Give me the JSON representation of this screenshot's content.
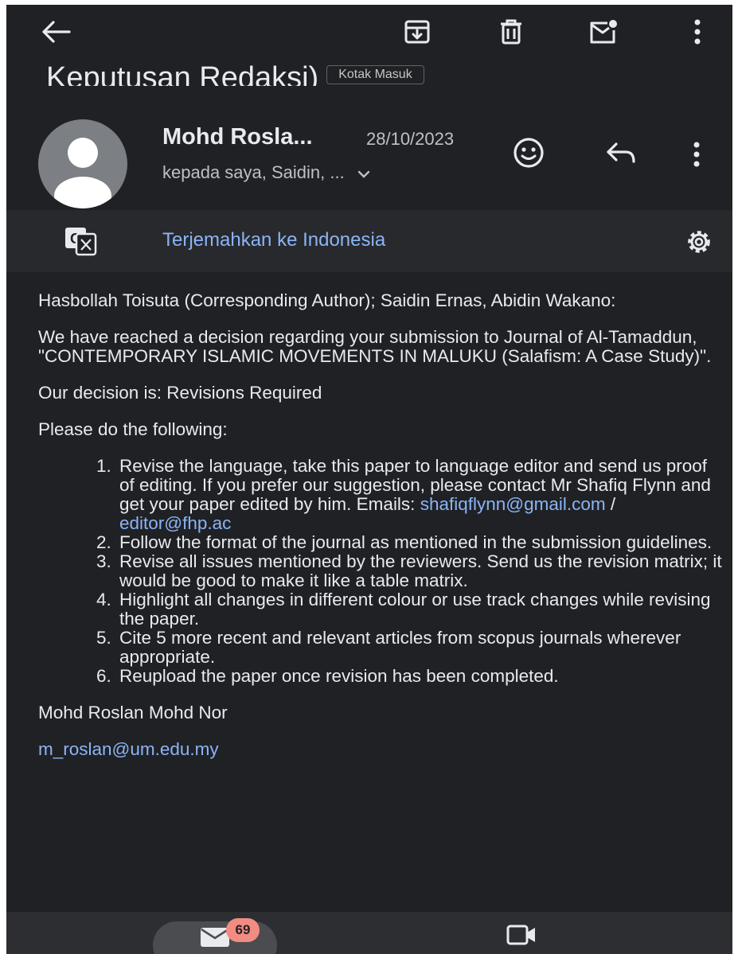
{
  "email": {
    "subject_tail": "Keputusan Redaksi)",
    "label": "Kotak Masuk",
    "sender": "Mohd Rosla...",
    "date": "28/10/2023",
    "recipients": "kepada saya, Saidin, ..."
  },
  "translate": {
    "label": "Terjemahkan ke Indonesia"
  },
  "body": {
    "salutation": "Hasbollah Toisuta (Corresponding Author); Saidin Ernas, Abidin Wakano:",
    "intro": "We have reached a decision regarding your submission to Journal of Al-Tamaddun, \"CONTEMPORARY ISLAMIC MOVEMENTS IN MALUKU (Salafism: A Case Study)\".",
    "decision": "Our decision is: Revisions Required",
    "instruction": "Please do the following:",
    "item1_text": "Revise the language, take this paper to language editor and send us proof of editing. If you prefer our suggestion, please contact Mr Shafiq Flynn and get your paper edited by him. Emails:",
    "item1_email1": "shafiqflynn@gmail.com",
    "item1_sep": " / ",
    "item1_email2": "editor@fhp.ac",
    "item2": "Follow the format of the journal as mentioned in the submission guidelines.",
    "item3": "Revise all issues mentioned by the reviewers. Send us the revision matrix; it would be good to make it like a table matrix.",
    "item4": "Highlight all changes in different colour or use track changes while revising the paper.",
    "item5": "Cite 5 more recent and relevant articles from scopus journals wherever appropriate.",
    "item6": "Reupload the paper once revision has been completed.",
    "signature": "Mohd Roslan Mohd Nor",
    "sig_email": "m_roslan@um.edu.my"
  },
  "bottom_nav": {
    "mail_badge": "69"
  },
  "icons": {
    "back": "arrow-left-icon",
    "archive": "archive-icon",
    "delete": "trash-icon",
    "mark_unread": "mark-unread-icon",
    "more": "more-vert-icon",
    "emoji": "emoji-icon",
    "reply": "reply-icon",
    "translate": "translate-icon",
    "settings": "gear-icon",
    "mail": "mail-icon",
    "meet": "video-icon"
  },
  "colors": {
    "background": "#202124",
    "text": "#e8eaed",
    "link": "#8ab4f8",
    "badge": "#f28b82"
  }
}
